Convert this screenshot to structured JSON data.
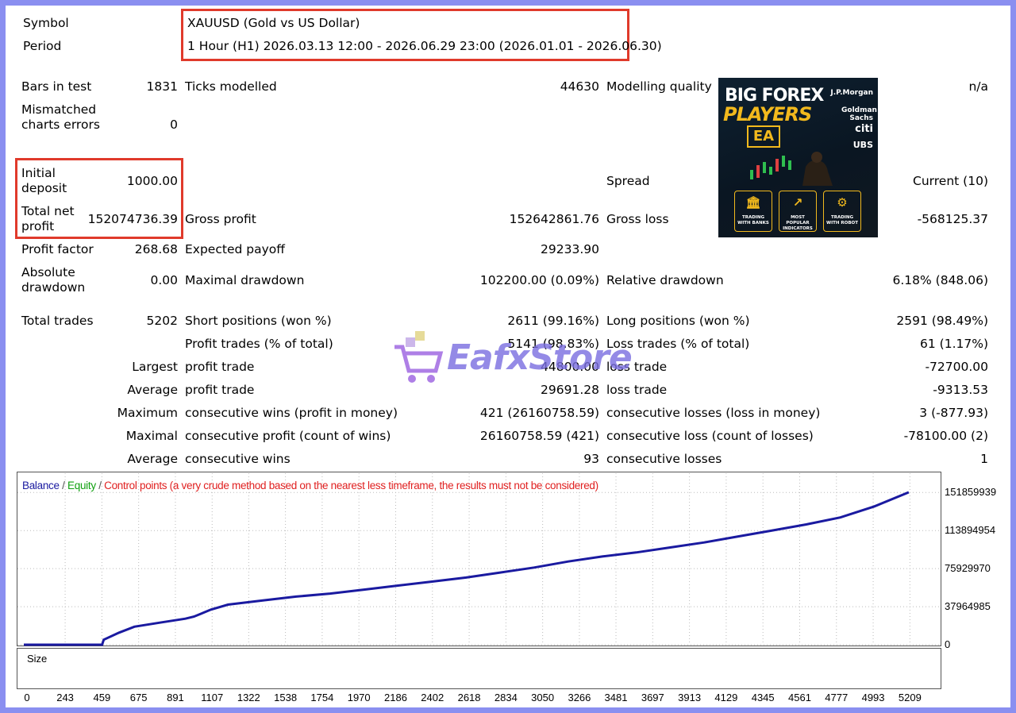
{
  "header": {
    "symbol_label": "Symbol",
    "symbol_value": "XAUUSD (Gold vs US Dollar)",
    "period_label": "Period",
    "period_value": "1 Hour (H1) 2026.03.13 12:00 - 2026.06.29 23:00 (2026.01.01 - 2026.06.30)"
  },
  "stats": {
    "bars_label": "Bars in test",
    "bars_value": "1831",
    "ticks_label": "Ticks modelled",
    "ticks_value": "44630",
    "quality_label": "Modelling quality",
    "quality_value": "n/a",
    "mismatch_label": "Mismatched charts errors",
    "mismatch_value": "0",
    "deposit_label": "Initial deposit",
    "deposit_value": "1000.00",
    "spread_label": "Spread",
    "spread_value": "Current (10)",
    "net_label": "Total net profit",
    "net_value": "152074736.39",
    "gross_profit_label": "Gross profit",
    "gross_profit_value": "152642861.76",
    "gross_loss_label": "Gross loss",
    "gross_loss_value": "-568125.37",
    "pf_label": "Profit factor",
    "pf_value": "268.68",
    "payoff_label": "Expected payoff",
    "payoff_value": "29233.90",
    "abs_dd_label": "Absolute drawdown",
    "abs_dd_value": "0.00",
    "max_dd_label": "Maximal drawdown",
    "max_dd_value": "102200.00 (0.09%)",
    "rel_dd_label": "Relative drawdown",
    "rel_dd_value": "6.18% (848.06)",
    "trades_label": "Total trades",
    "trades_value": "5202",
    "short_label": "Short positions (won %)",
    "short_value": "2611 (99.16%)",
    "long_label": "Long positions (won %)",
    "long_value": "2591 (98.49%)",
    "profit_trades_label": "Profit trades (% of total)",
    "profit_trades_value": "5141 (98.83%)",
    "loss_trades_label": "Loss trades (% of total)",
    "loss_trades_value": "61 (1.17%)",
    "largest_label": "Largest",
    "largest_profit_label": "profit trade",
    "largest_profit_value": "44800.00",
    "largest_loss_label": "loss trade",
    "largest_loss_value": "-72700.00",
    "average_label": "Average",
    "avg_profit_label": "profit trade",
    "avg_profit_value": "29691.28",
    "avg_loss_label": "loss trade",
    "avg_loss_value": "-9313.53",
    "maximum_label": "Maximum",
    "max_wins_label": "consecutive wins (profit in money)",
    "max_wins_value": "421 (26160758.59)",
    "max_losses_label": "consecutive losses (loss in money)",
    "max_losses_value": "3 (-877.93)",
    "maximal_label": "Maximal",
    "maximal_profit_label": "consecutive profit (count of wins)",
    "maximal_profit_value": "26160758.59 (421)",
    "maximal_loss_label": "consecutive loss (count of losses)",
    "maximal_loss_value": "-78100.00 (2)",
    "average2_label": "Average",
    "avg_wins_label": "consecutive wins",
    "avg_wins_value": "93",
    "avg_losses_label": "consecutive losses",
    "avg_losses_value": "1"
  },
  "ad": {
    "line1": "BIG FOREX",
    "line2": "PLAYERS",
    "line3": "EA",
    "banks": [
      "J.P.Morgan",
      "Goldman Sachs",
      "citi",
      "UBS"
    ],
    "tiles": [
      "TRADING WITH BANKS",
      "MOST POPULAR INDICATORS",
      "TRADING WITH ROBOT"
    ]
  },
  "watermark": "EafxStore",
  "chart_data": {
    "type": "line",
    "legend": {
      "balance": "Balance",
      "equity": "Equity",
      "control": "Control points (a very crude method based on the nearest less timeframe, the results must not be considered)",
      "sep": " / "
    },
    "size_label": "Size",
    "y_ticks": [
      "151859939",
      "113894954",
      "75929970",
      "37964985",
      "0"
    ],
    "y_tick_values": [
      151859939,
      113894954,
      75929970,
      37964985,
      0
    ],
    "ylim": [
      0,
      152074736
    ],
    "x_ticks": [
      "0",
      "243",
      "459",
      "675",
      "891",
      "1107",
      "1322",
      "1538",
      "1754",
      "1970",
      "2186",
      "2402",
      "2618",
      "2834",
      "3050",
      "3266",
      "3481",
      "3697",
      "3913",
      "4129",
      "4345",
      "4561",
      "4777",
      "4993",
      "5209"
    ],
    "xlim": [
      0,
      5380
    ],
    "series": [
      {
        "name": "Balance",
        "color": "#1a1aa0",
        "x": [
          0,
          460,
          470,
          560,
          650,
          800,
          950,
          1000,
          1100,
          1200,
          1400,
          1600,
          1800,
          2000,
          2200,
          2400,
          2600,
          2800,
          3000,
          3200,
          3400,
          3600,
          3800,
          4000,
          4200,
          4400,
          4600,
          4800,
          5000,
          5202
        ],
        "values": [
          1000,
          1000,
          5000000,
          12000000,
          18000000,
          22000000,
          26000000,
          28000000,
          35000000,
          40000000,
          44000000,
          48000000,
          51000000,
          55000000,
          59000000,
          63000000,
          67000000,
          72000000,
          77000000,
          83000000,
          88000000,
          92000000,
          97000000,
          102000000,
          108000000,
          114000000,
          120000000,
          127000000,
          138000000,
          152074736
        ]
      }
    ],
    "size_series": {
      "color": "#00aa00",
      "start_x": 430,
      "ramp_end_x": 475,
      "level": 1.0
    },
    "colors": {
      "balance": "#1a1aa0",
      "equity": "#10a010",
      "control": "#e02020",
      "size": "#00aa00"
    }
  }
}
